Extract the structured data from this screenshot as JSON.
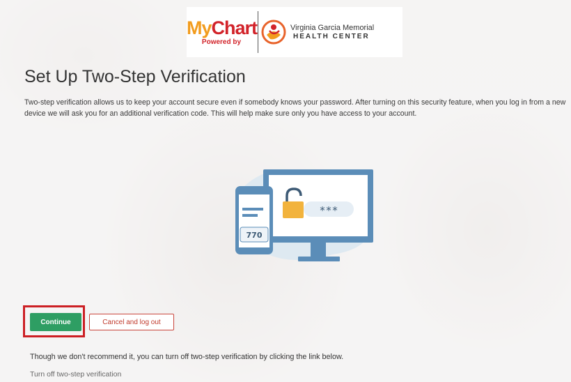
{
  "logo": {
    "my": "My",
    "chart": "Chart",
    "powered_by": "Powered by",
    "org_line1": "Virginia Garcia Memorial",
    "org_line2": "HEALTH CENTER"
  },
  "page": {
    "title": "Set Up Two-Step Verification",
    "description": "Two-step verification allows us to keep your account secure even if somebody knows your password. After turning on this security feature, when you log in from a new device we will ask you for an additional verification code. This will help make sure only you have access to your account."
  },
  "illustration": {
    "phone_code": "770",
    "password_mask": "***",
    "icons": [
      "phone-icon",
      "monitor-icon",
      "padlock-icon"
    ]
  },
  "actions": {
    "continue_label": "Continue",
    "cancel_label": "Cancel and log out"
  },
  "footer": {
    "note": "Though we don't recommend it, you can turn off two-step verification by clicking the link below.",
    "turn_off_link": "Turn off two-step verification"
  },
  "colors": {
    "primary_button": "#2e9e63",
    "highlight": "#cc1f24",
    "cancel_text": "#c0392b",
    "mychart_orange": "#f29c1e",
    "mychart_red": "#d2232a",
    "illustration_blue": "#5b8db8"
  }
}
